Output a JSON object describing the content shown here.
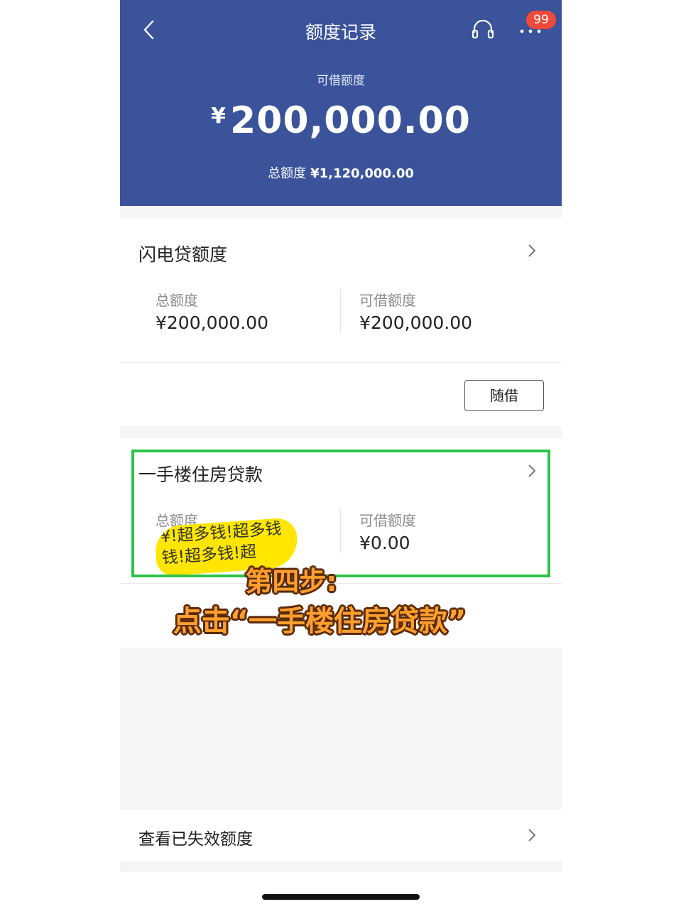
{
  "header": {
    "title": "额度记录",
    "badge": "99",
    "available_label": "可借额度",
    "currency_symbol": "¥",
    "available_amount": "200,000.00",
    "total_label": "总额度",
    "total_value": "¥1,120,000.00",
    "bg_color": "#3a539b"
  },
  "card1": {
    "title": "闪电贷额度",
    "total_label": "总额度",
    "total_value": "¥200,000.00",
    "avail_label": "可借额度",
    "avail_value": "¥200,000.00",
    "borrow_button": "随借"
  },
  "card2": {
    "title": "一手楼住房贷款",
    "total_label": "总额度",
    "sticker_text_1": "¥!超多钱!超多钱",
    "sticker_text_2": "钱!超多钱!超",
    "avail_label": "可借额度",
    "avail_value": "¥0.00"
  },
  "overlay": {
    "line1": "第四步:",
    "line2": "点击“一手楼住房贷款”",
    "highlight_color": "#2fc249"
  },
  "footer": {
    "expired_label": "查看已失效额度"
  }
}
